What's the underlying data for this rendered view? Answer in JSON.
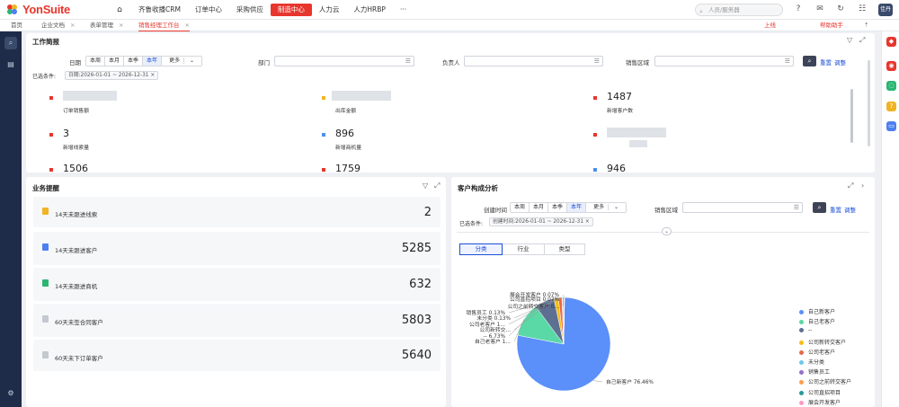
{
  "header": {
    "brand": "YonSuite",
    "nav": [
      "齐鲁收播CRM",
      "订单中心",
      "采购供应",
      "制造中心",
      "人力云",
      "人力HRBP"
    ],
    "more": "···",
    "search_placeholder": "人员/服务器",
    "avatar_text": "佳丹"
  },
  "tabs": {
    "home": "首页",
    "items": [
      {
        "label": "企业文档"
      },
      {
        "label": "表单管理"
      },
      {
        "label": "销售经理工作台"
      }
    ],
    "right_online": "上线",
    "right_assistant": "帮助助手"
  },
  "work_report": {
    "title": "工作简报",
    "filters": {
      "date_label": "日期",
      "date_options": [
        "本周",
        "本月",
        "本季",
        "本年",
        "更多"
      ],
      "dept_label": "部门",
      "owner_label": "负责人",
      "region_label": "销售区域",
      "reset": "重置",
      "adjust": "调整",
      "selected_label": "已选条件:",
      "selected_chip": "日期:2026-01-01 ~ 2026-12-31"
    },
    "kpis": [
      {
        "value": "",
        "caption": "订单销售额",
        "color": "#e7362d"
      },
      {
        "value": "",
        "caption": "出库金额",
        "color": "#f0b323"
      },
      {
        "value": "1487",
        "caption": "新增客户数",
        "color": "#e7362d"
      },
      {
        "value": "3",
        "caption": "新增线索量",
        "color": "#e7362d"
      },
      {
        "value": "896",
        "caption": "新增商机量",
        "color": "#4d8ff0"
      },
      {
        "value": "",
        "caption": "",
        "color": "#e7362d"
      },
      {
        "value": "1506",
        "caption": "",
        "color": "#e7362d"
      },
      {
        "value": "1759",
        "caption": "",
        "color": "#e7362d"
      },
      {
        "value": "946",
        "caption": "",
        "color": "#4d8ff0"
      }
    ]
  },
  "business_alerts": {
    "title": "业务提醒",
    "rows": [
      {
        "label": "14天未跟进线索",
        "value": "2",
        "color": "#f0b323"
      },
      {
        "label": "14天未跟进客户",
        "value": "5285",
        "color": "#4d7ff0"
      },
      {
        "label": "14天未跟进商机",
        "value": "632",
        "color": "#2bb673"
      },
      {
        "label": "60天未签合同客户",
        "value": "5803",
        "color": "#c4c8cf"
      },
      {
        "label": "60天未下订单客户",
        "value": "5640",
        "color": "#c4c8cf"
      }
    ]
  },
  "customer_analysis": {
    "title": "客户构成分析",
    "filters": {
      "time_label": "创建时间",
      "time_options": [
        "本周",
        "本月",
        "本季",
        "本年",
        "更多"
      ],
      "region_label": "销售区域",
      "reset": "重置",
      "adjust": "调整",
      "selected_label": "已选条件:",
      "selected_chip": "创建时间:2026-01-01 ~ 2026-12-31"
    },
    "view_tabs": [
      "分类",
      "行业",
      "类型"
    ]
  },
  "chart_data": {
    "type": "pie",
    "slices": [
      {
        "name": "自己新客户",
        "value": 76.46,
        "label": "自己新客户 76.46%",
        "color": "#5b8ff9"
      },
      {
        "name": "自己老客户",
        "value": 11.6,
        "label": "自己老客户 1...",
        "color": "#5ad8a6"
      },
      {
        "name": "--",
        "value": 6.73,
        "label": "-- 6.73%",
        "color": "#5d7092"
      },
      {
        "name": "公司新转交客户",
        "value": 1.5,
        "label": "公司新转交...",
        "color": "#f6bd16"
      },
      {
        "name": "公司老客户",
        "value": 1.2,
        "label": "公司老客户 1...",
        "color": "#e8684a"
      },
      {
        "name": "未分类",
        "value": 0.13,
        "label": "未分类 0.13%",
        "color": "#6dc8ec"
      },
      {
        "name": "销售员工",
        "value": 0.13,
        "label": "销售员工 0.13%",
        "color": "#9270ca"
      },
      {
        "name": "公司之前转交客户",
        "value": 0.5,
        "label": "公司之前转交客户 0...",
        "color": "#ff9d4d"
      },
      {
        "name": "公司直招项目",
        "value": 0.07,
        "label": "公司直招项目 0.07%",
        "color": "#269a99"
      },
      {
        "name": "展会开发客户",
        "value": 0.07,
        "label": "展会开发客户 0.07%",
        "color": "#ff99c3"
      }
    ],
    "legend": [
      "自己新客户",
      "自己老客户",
      "--",
      "公司新转交客户",
      "公司老客户",
      "未分类",
      "销售员工",
      "公司之前转交客户",
      "公司直招项目",
      "展会开发客户"
    ]
  }
}
